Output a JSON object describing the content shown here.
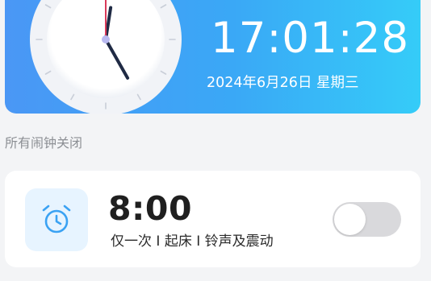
{
  "header": {
    "time": "17:01:28",
    "date": "2024年6月26日 星期三"
  },
  "status": {
    "text": "所有闹钟关闭"
  },
  "alarm": {
    "time": "8:00",
    "description": "仅一次 I 起床 I 铃声及震动",
    "enabled": false,
    "icon": "alarm-clock-icon"
  },
  "colors": {
    "gradient_start": "#4a97f5",
    "gradient_end": "#35ccf8",
    "page_bg": "#f3f4f6",
    "card_bg": "#ffffff",
    "icon_bg": "#e7f4ff",
    "icon_color": "#3aa2f3",
    "toggle_off": "#d9d9dc",
    "secondary_hand": "#d93a5a",
    "hand": "#1f2a44"
  },
  "clock": {
    "hour": 17,
    "minute": 1,
    "second": 28
  }
}
